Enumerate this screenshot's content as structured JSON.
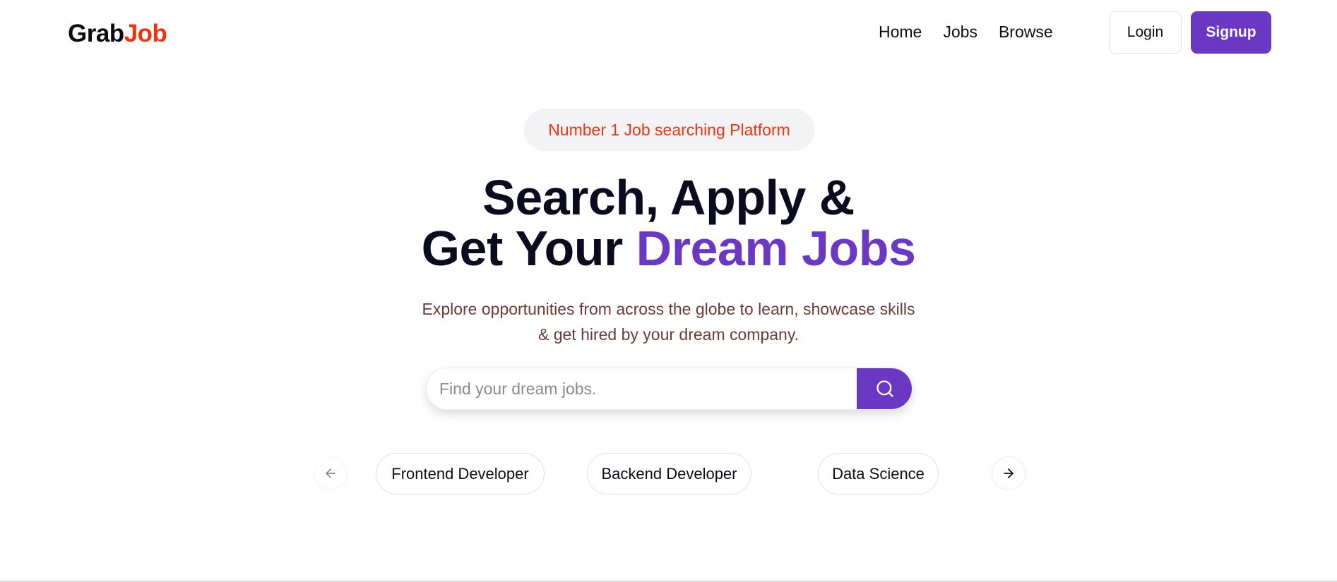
{
  "header": {
    "logo_part1": "Grab",
    "logo_part2": "Job",
    "nav": {
      "home": "Home",
      "jobs": "Jobs",
      "browse": "Browse"
    },
    "login_label": "Login",
    "signup_label": "Signup"
  },
  "hero": {
    "badge": "Number 1 Job searching Platform",
    "headline_line1": "Search, Apply &",
    "headline_line2_plain": "Get Your ",
    "headline_line2_accent": "Dream Jobs",
    "subtitle_line1": "Explore opportunities from across the globe to learn, showcase skills",
    "subtitle_line2": "& get hired by your dream company."
  },
  "search": {
    "placeholder": "Find your dream jobs.",
    "value": "",
    "button_icon": "search-icon"
  },
  "carousel": {
    "prev_icon": "arrow-left-icon",
    "next_icon": "arrow-right-icon",
    "categories": [
      "Frontend Developer",
      "Backend Developer",
      "Data Science"
    ]
  },
  "colors": {
    "brand_purple": "#6a38c2",
    "accent_red": "#f0330c",
    "subtitle_brown": "#6a3b34",
    "badge_bg": "#f3f3f5"
  }
}
